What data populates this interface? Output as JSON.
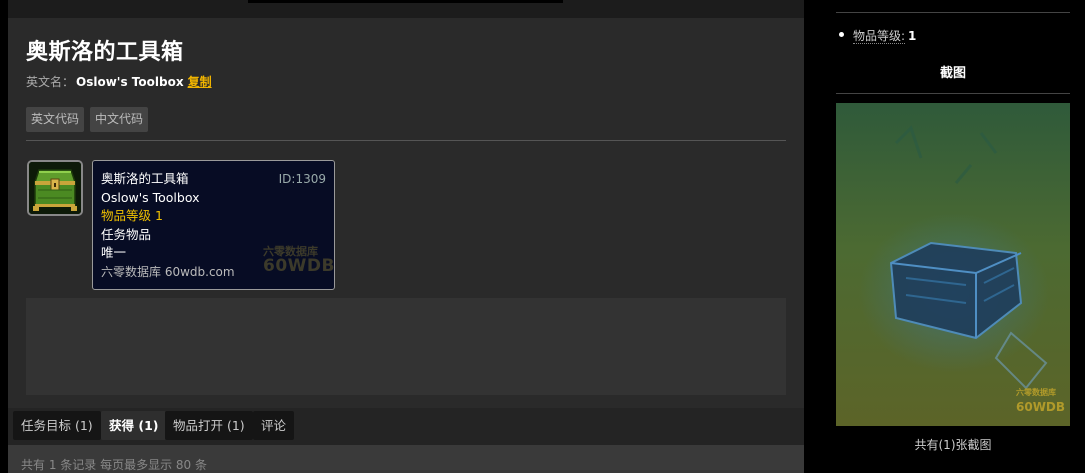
{
  "item": {
    "title": "奥斯洛的工具箱",
    "en_name_label": "英文名：",
    "en_name": "Oslow's Toolbox",
    "copy_label": "复制"
  },
  "code_buttons": {
    "english": "英文代码",
    "chinese": "中文代码"
  },
  "tooltip": {
    "name": "奥斯洛的工具箱",
    "id": "ID:1309",
    "en_name": "Oslow's Toolbox",
    "item_level": "物品等级 1",
    "type": "任务物品",
    "binding": "唯一",
    "source": "六零数据库 60wdb.com",
    "watermark_cn": "六零数据库",
    "watermark_en": "60WDB"
  },
  "tabs": [
    {
      "label": "任务目标 (1)"
    },
    {
      "label": "获得 (1)"
    },
    {
      "label": "物品打开 (1)"
    },
    {
      "label": "评论"
    }
  ],
  "footer": {
    "text": "共有 1 条记录 每页最多显示 80 条"
  },
  "sidebar": {
    "level_label": "物品等级:",
    "level_value": "1",
    "screenshot_title": "截图",
    "screenshot_count": "共有(1)张截图",
    "watermark_cn": "六零数据库",
    "watermark_en": "60WDB"
  },
  "colors": {
    "accent": "#f0b400",
    "tooltip_bg": "#070c24",
    "item_level": "#f0c000"
  }
}
